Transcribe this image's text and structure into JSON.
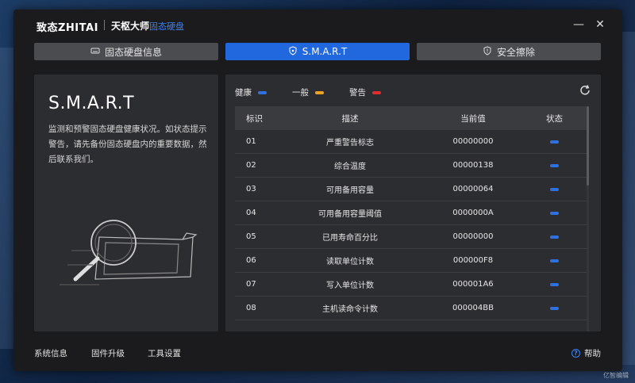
{
  "brand": "致态ZHITAI",
  "app": {
    "name": "天枢大师",
    "subtitle": "固态硬盘"
  },
  "window": {
    "minimize": "—",
    "close": "✕"
  },
  "tabs": [
    {
      "label": "固态硬盘信息",
      "icon": "drive-icon"
    },
    {
      "label": "S.M.A.R.T",
      "icon": "shield-icon"
    },
    {
      "label": "安全擦除",
      "icon": "shield-alert-icon"
    }
  ],
  "left": {
    "title": "S.M.A.R.T",
    "description": "监测和预警固态硬盘健康状况。如状态提示警告，请先备份固态硬盘内的重要数据，然后联系我们。"
  },
  "legend": [
    {
      "label": "健康",
      "color": "#2f6fe0"
    },
    {
      "label": "一般",
      "color": "#f0a020"
    },
    {
      "label": "警告",
      "color": "#e02d2d"
    }
  ],
  "table": {
    "headers": [
      "标识",
      "描述",
      "当前值",
      "状态"
    ],
    "rows": [
      {
        "id": "01",
        "desc": "严重警告标志",
        "value": "00000000",
        "status": "健康"
      },
      {
        "id": "02",
        "desc": "综合温度",
        "value": "00000138",
        "status": "健康"
      },
      {
        "id": "03",
        "desc": "可用备用容量",
        "value": "00000064",
        "status": "健康"
      },
      {
        "id": "04",
        "desc": "可用备用容量阈值",
        "value": "0000000A",
        "status": "健康"
      },
      {
        "id": "05",
        "desc": "已用寿命百分比",
        "value": "00000000",
        "status": "健康"
      },
      {
        "id": "06",
        "desc": "读取单位计数",
        "value": "000000F8",
        "status": "健康"
      },
      {
        "id": "07",
        "desc": "写入单位计数",
        "value": "000001A6",
        "status": "健康"
      },
      {
        "id": "08",
        "desc": "主机读命令计数",
        "value": "000004BB",
        "status": "健康"
      }
    ]
  },
  "footer": {
    "links": [
      "系统信息",
      "固件升级",
      "工具设置"
    ],
    "help": "帮助"
  },
  "watermark": "亿智编辑"
}
